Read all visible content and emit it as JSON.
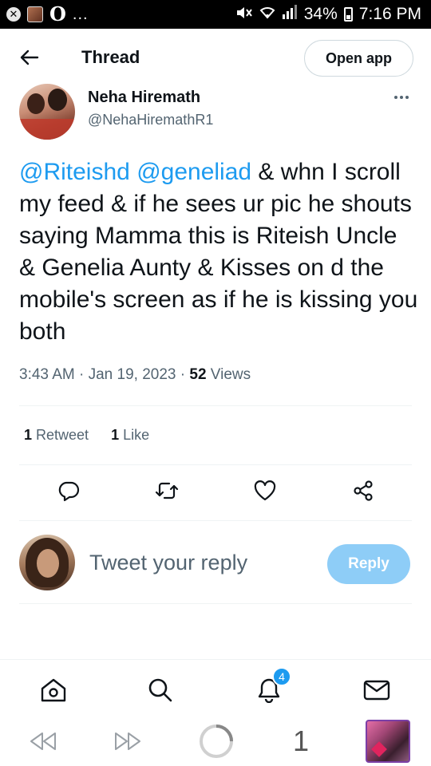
{
  "status_bar": {
    "left_glyph": "O",
    "left_dots": "...",
    "battery": "34%",
    "time": "7:16 PM"
  },
  "header": {
    "title": "Thread",
    "open_app_label": "Open app"
  },
  "tweet": {
    "author_name": "Neha Hiremath",
    "author_handle": "@NehaHiremathR1",
    "mention_1": "@Riteishd",
    "mention_2": "@geneliad",
    "text": " & whn I scroll my feed & if he sees ur pic he shouts saying Mamma this is Riteish Uncle & Genelia Aunty & Kisses on d the mobile's screen as if he is kissing you both",
    "time": "3:43 AM",
    "separator": " · ",
    "date": "Jan 19, 2023",
    "views_count": "52",
    "views_label": " Views"
  },
  "stats": {
    "retweets_count": "1",
    "retweets_label": " Retweet",
    "likes_count": "1",
    "likes_label": " Like"
  },
  "reply": {
    "placeholder": "Tweet your reply",
    "button_label": "Reply"
  },
  "bottom_nav": {
    "notifications_badge": "4"
  },
  "browser_bar": {
    "tab_count": "1"
  },
  "colors": {
    "accent": "#1d9bf0",
    "reply_button_disabled": "#8ecdf7",
    "secondary_text": "#536471"
  },
  "icons": [
    "back-arrow-icon",
    "more-icon",
    "reply-icon",
    "retweet-icon",
    "like-icon",
    "share-icon",
    "home-icon",
    "search-icon",
    "notifications-icon",
    "messages-icon",
    "rewind-icon",
    "fast-forward-icon",
    "loading-spinner-icon"
  ]
}
